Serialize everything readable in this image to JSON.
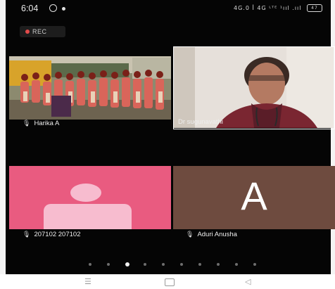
{
  "status_bar": {
    "time": "6:04",
    "network_text": "4G.0 ꟾ 4G ᴸᵀᴱ ¹ııl .ııl",
    "battery_text": "47"
  },
  "recording": {
    "label": "REC",
    "color": "#e24b4b"
  },
  "participants": [
    {
      "name": "Harika A",
      "type": "video"
    },
    {
      "name": "Dr sugunavathi",
      "type": "video"
    },
    {
      "name": "207102 207102",
      "type": "avatar",
      "tile_color": "#e95b80"
    },
    {
      "name": "Aduri Anusha",
      "type": "letter",
      "letter": "A",
      "tile_color": "#6e4b3f"
    }
  ],
  "pagination": {
    "pages": 10,
    "current": 3
  },
  "nav_icons": [
    "menu-icon",
    "home-square-icon",
    "back-triangle-icon"
  ]
}
